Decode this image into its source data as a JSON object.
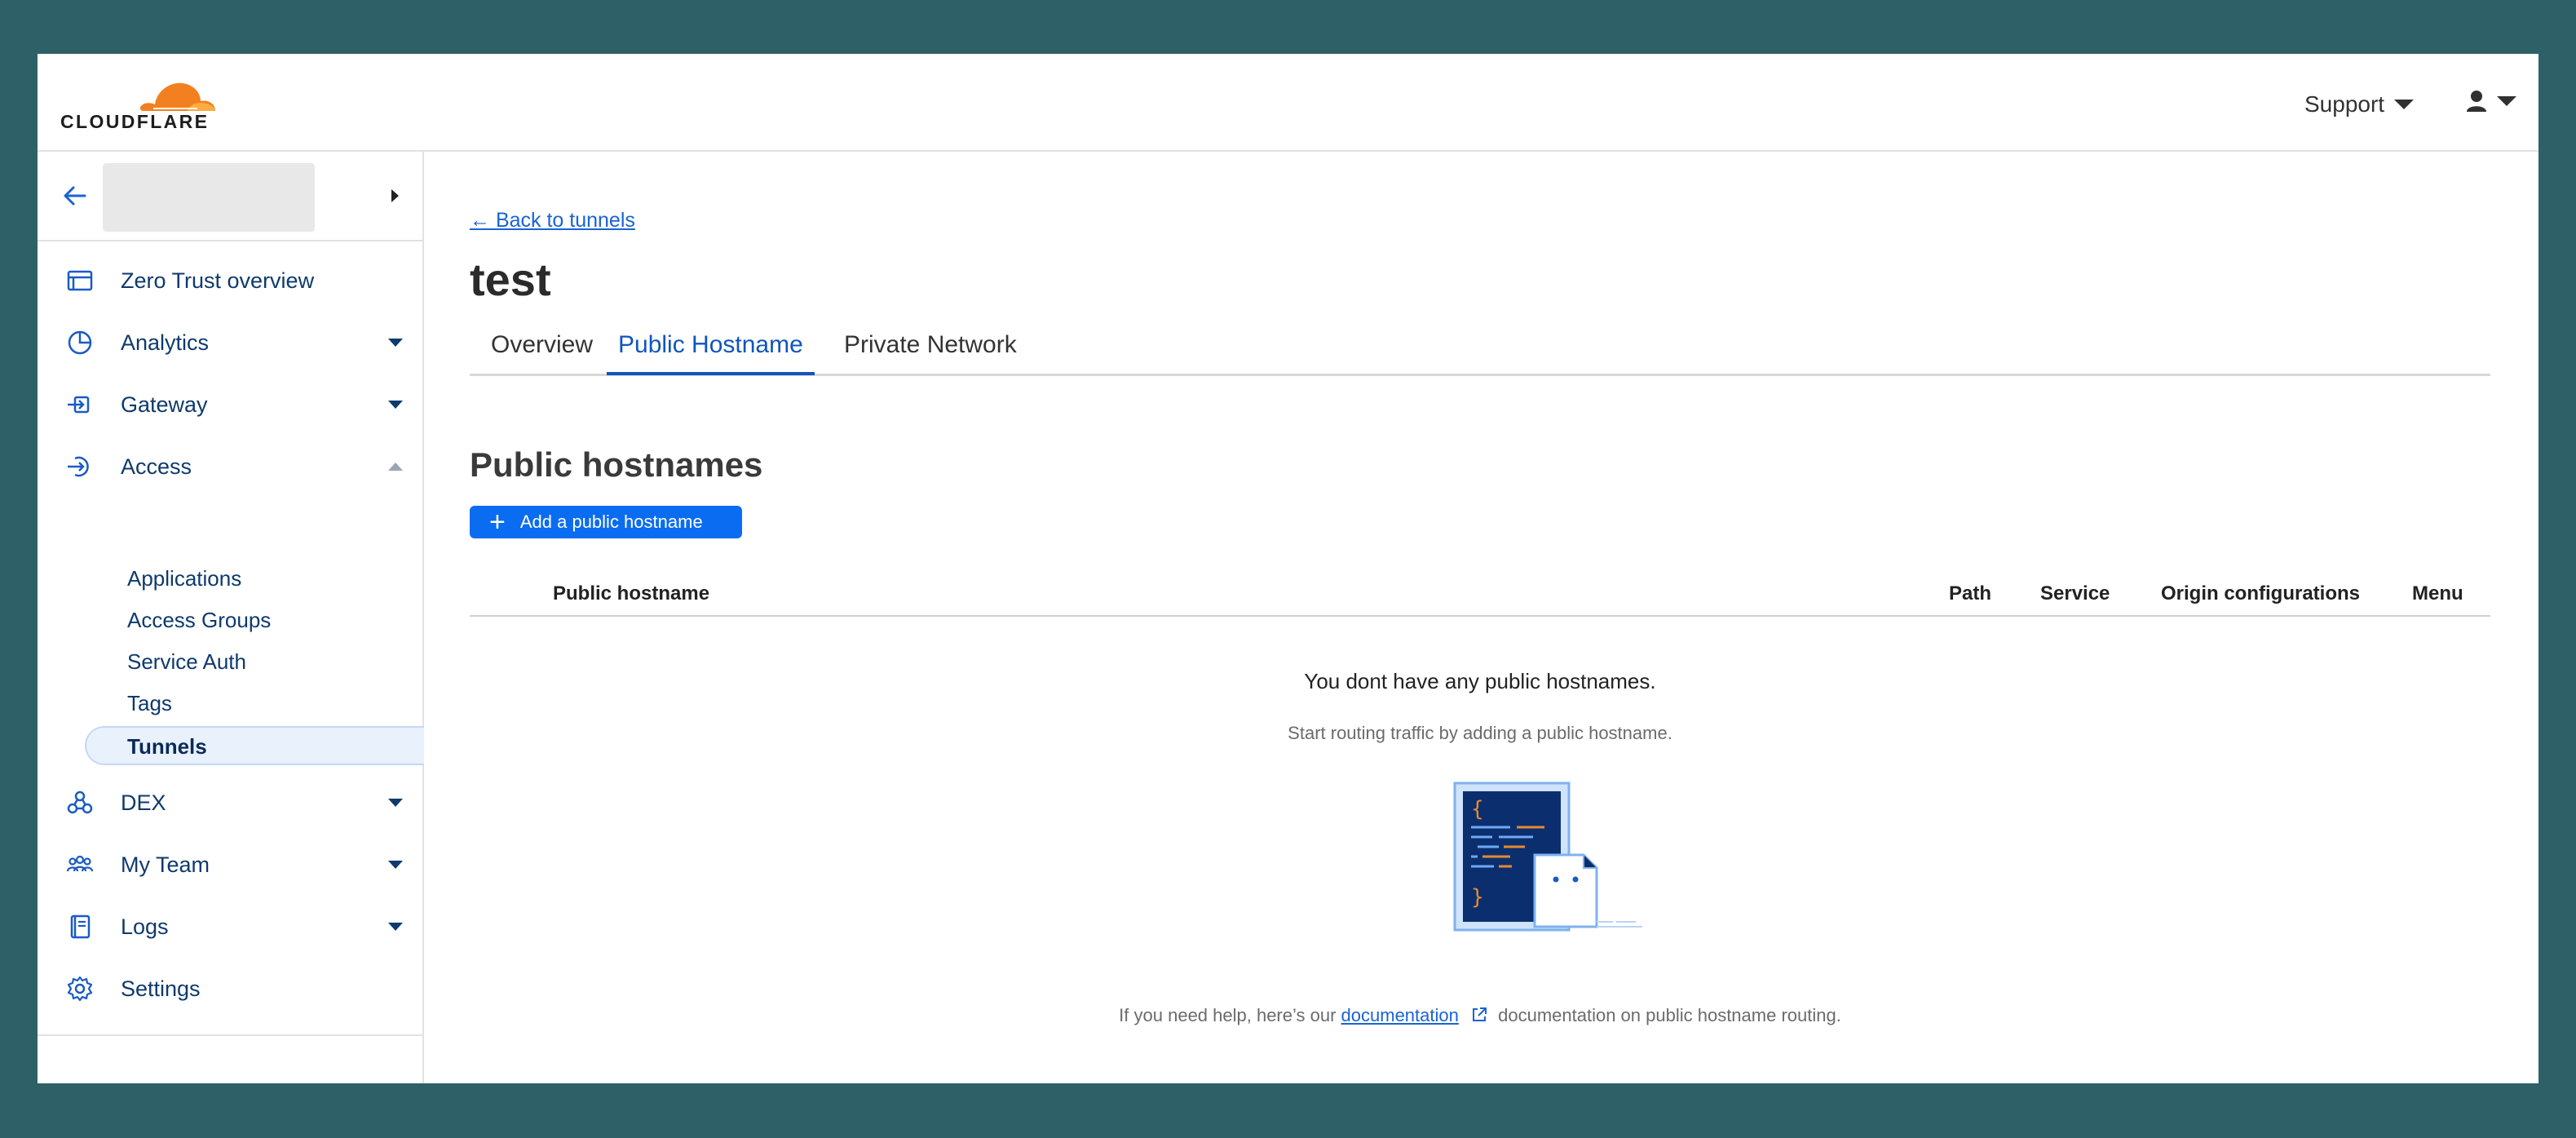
{
  "brand": {
    "logo_text": "CLOUDFLARE",
    "accent": "#f38020"
  },
  "topbar": {
    "support_label": "Support",
    "user_icon": "user-icon"
  },
  "sidebar": {
    "items": [
      {
        "label": "Zero Trust overview",
        "icon": "browser-window-icon",
        "expandable": false
      },
      {
        "label": "Analytics",
        "icon": "pie-chart-icon",
        "expandable": true
      },
      {
        "label": "Gateway",
        "icon": "gateway-icon",
        "expandable": true
      },
      {
        "label": "Access",
        "icon": "access-icon",
        "expandable": true,
        "expanded": true
      },
      {
        "label": "DEX",
        "icon": "dex-icon",
        "expandable": true
      },
      {
        "label": "My Team",
        "icon": "team-icon",
        "expandable": true
      },
      {
        "label": "Logs",
        "icon": "logs-icon",
        "expandable": true
      },
      {
        "label": "Settings",
        "icon": "gear-icon",
        "expandable": false
      }
    ],
    "access_sub": [
      "Applications",
      "Access Groups",
      "Service Auth",
      "Tags",
      "Tunnels"
    ],
    "active_sub": "Tunnels"
  },
  "main": {
    "back_link": "← Back to tunnels",
    "title": "test",
    "tabs": [
      {
        "label": "Overview",
        "active": false
      },
      {
        "label": "Public Hostname",
        "active": true
      },
      {
        "label": "Private Network",
        "active": false
      }
    ],
    "section_title": "Public hostnames",
    "add_button": "Add a public hostname",
    "columns": [
      "Public hostname",
      "Path",
      "Service",
      "Origin configurations",
      "Menu"
    ],
    "empty_title": "You dont have any public hostnames.",
    "empty_sub": "Start routing traffic by adding a public hostname.",
    "help": {
      "prefix": "If you need help, here’s our",
      "link": "documentation",
      "suffix": "documentation on public hostname routing."
    }
  },
  "colors": {
    "link": "#1a63d4",
    "primary_button": "#0a6cf0",
    "nav_text": "#0e3a6d"
  }
}
